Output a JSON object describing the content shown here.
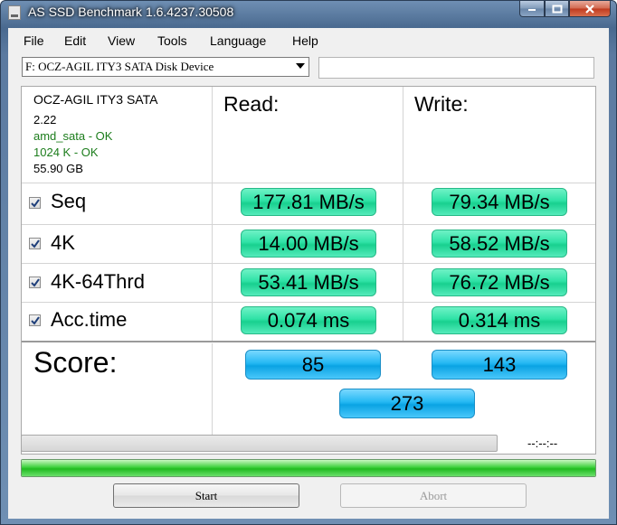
{
  "window": {
    "title": "AS SSD Benchmark 1.6.4237.30508"
  },
  "menu": [
    "File",
    "Edit",
    "View",
    "Tools",
    "Language",
    "Help"
  ],
  "drive_select": {
    "value": "F: OCZ-AGIL ITY3 SATA Disk Device"
  },
  "info": {
    "model": "OCZ-AGIL ITY3 SATA",
    "firmware": "2.22",
    "driver": "amd_sata - OK",
    "alignment": "1024 K - OK",
    "size": "55.90 GB"
  },
  "headers": {
    "read": "Read:",
    "write": "Write:"
  },
  "rows": [
    {
      "label": "Seq",
      "checked": true,
      "read": "177.81 MB/s",
      "write": "79.34 MB/s"
    },
    {
      "label": "4K",
      "checked": true,
      "read": "14.00 MB/s",
      "write": "58.52 MB/s"
    },
    {
      "label": "4K-64Thrd",
      "checked": true,
      "read": "53.41 MB/s",
      "write": "76.72 MB/s"
    },
    {
      "label": "Acc.time",
      "checked": true,
      "read": "0.074 ms",
      "write": "0.314 ms"
    }
  ],
  "score": {
    "label": "Score:",
    "read": "85",
    "write": "143",
    "total": "273"
  },
  "progress": {
    "time": "--:--:--",
    "top_fraction": 0.0,
    "bottom_fraction": 1.0
  },
  "buttons": {
    "start": "Start",
    "abort": "Abort"
  },
  "colors": {
    "result_green": "#2fe2a6",
    "score_blue": "#24b8f3",
    "progress_green": "#20bb20",
    "ok_text": "#1c7d1c"
  }
}
